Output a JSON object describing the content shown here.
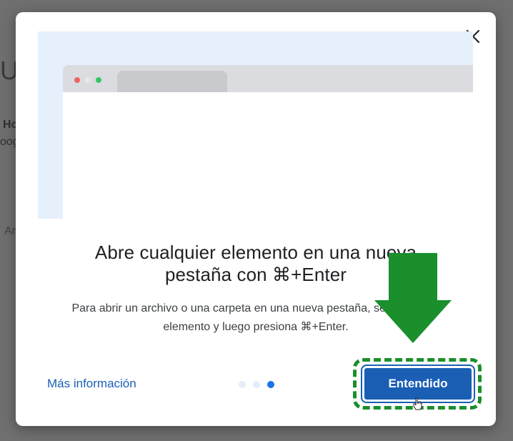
{
  "background": {
    "fragments": [
      "U",
      "Ho",
      "oog",
      "Ar"
    ]
  },
  "dialog": {
    "close_icon": "close-icon",
    "illustration": {
      "description_icon": "browser-window-illustration"
    },
    "title_line1": "Abre cualquier elemento en una nueva",
    "title_line2": "pestaña con ⌘+Enter",
    "body_line1": "Para abrir un archivo o una carpeta en una nueva pestaña, selecciona el",
    "body_line2": "elemento y luego presiona ⌘+Enter.",
    "learn_more": "Más información",
    "pagination": {
      "total": 3,
      "current": 3
    },
    "primary_button": "Entendido"
  },
  "annotation": {
    "arrow_color": "#1a8f2c",
    "highlight_color": "#1a8f2c"
  },
  "colors": {
    "accent": "#1a5fb4",
    "dot_active": "#1a73e8",
    "dot_inactive": "#e3ecf8"
  }
}
